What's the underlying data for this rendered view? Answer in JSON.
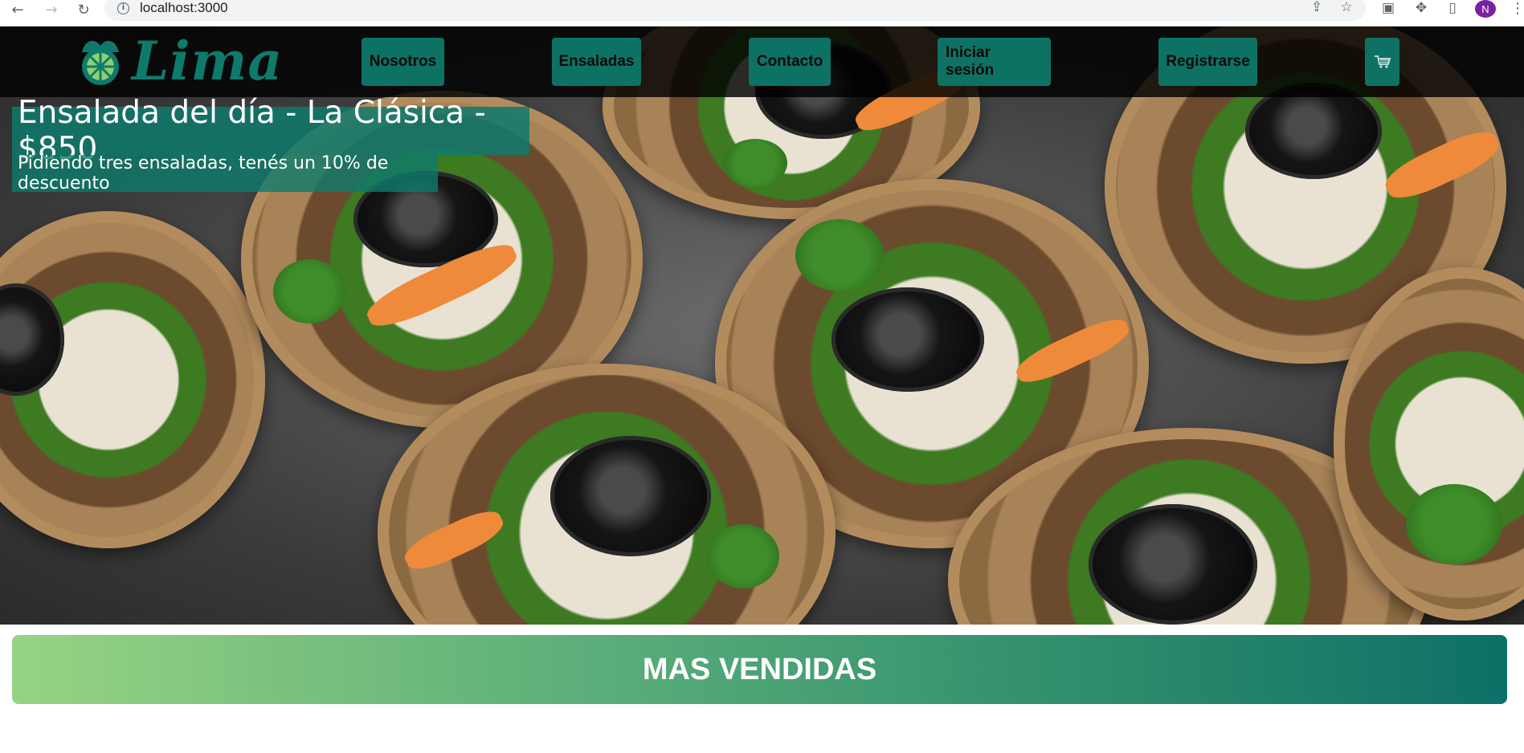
{
  "browser": {
    "url": "localhost:3000",
    "profile_initial": "N"
  },
  "navbar": {
    "logo_text": "Lima",
    "items": [
      {
        "label": "Nosotros"
      },
      {
        "label": "Ensaladas"
      },
      {
        "label": "Contacto"
      },
      {
        "label": "Iniciar sesión"
      },
      {
        "label": "Registrarse"
      }
    ],
    "cart_icon": "cart-icon"
  },
  "promo": {
    "title": "Ensalada del día - La Clásica - $850",
    "subtitle": "Pidiendo tres ensaladas, tenés un 10% de descuento"
  },
  "section": {
    "title": "MAS VENDIDAS"
  },
  "colors": {
    "brand": "#0e7a6c",
    "nav_button": "#0d7264",
    "gradient_start": "#97d383",
    "gradient_end": "#0d7068"
  }
}
